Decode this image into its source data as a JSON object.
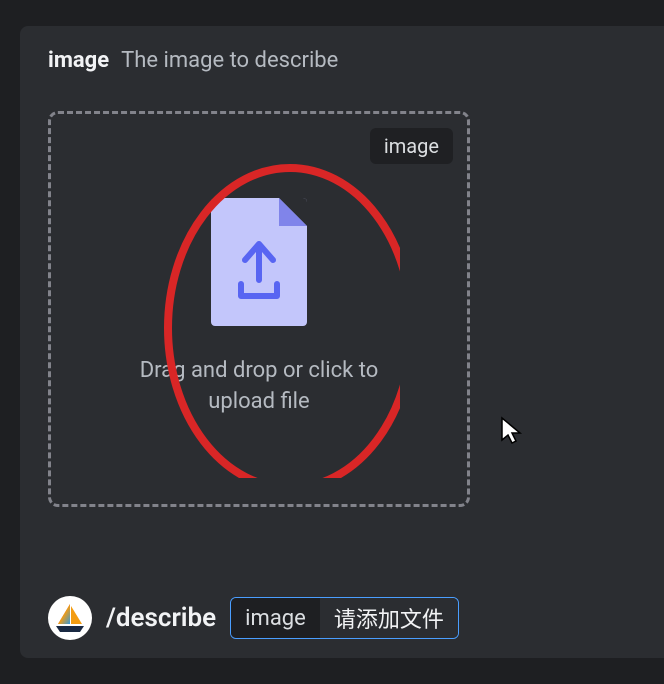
{
  "header": {
    "title": "image",
    "description": "The image to describe"
  },
  "dropzone": {
    "badge": "image",
    "instruction": "Drag and drop or click to upload file"
  },
  "command": {
    "text": "/describe",
    "param_name": "image",
    "param_value": "请添加文件"
  },
  "annotation": {
    "circle_color": "#d92626",
    "stroke_width": 8
  }
}
